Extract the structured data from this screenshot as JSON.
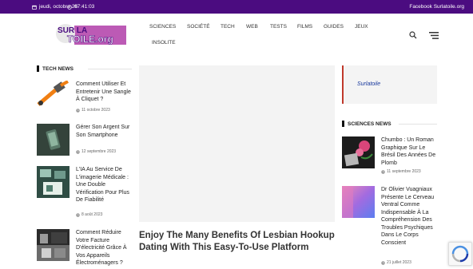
{
  "topbar": {
    "date": "jeudi, octobre 26",
    "time": "07:41:03",
    "facebook": "Facebook Surlatoile.org"
  },
  "logo": {
    "line1": "SUR LA",
    "line2": "TOILE.org"
  },
  "nav": {
    "items": [
      "SCIENCES",
      "SOCIÉTÉ",
      "TECH",
      "WEB",
      "TESTS",
      "FILMS",
      "GUIDES",
      "JEUX",
      "INSOLITE"
    ]
  },
  "icons": {
    "date": "calendar-icon",
    "time": "clock-icon",
    "search": "search-icon",
    "menu": "hamburger-menu-icon",
    "post_date": "clock-icon",
    "recaptcha": "recaptcha-icon"
  },
  "tech_news": {
    "title": "TECH NEWS",
    "posts": [
      {
        "title": "Comment Utiliser Et Entretenir Une Sangle À Cliquet ?",
        "date": "11 octobre 2023"
      },
      {
        "title": "Gérer Son Argent Sur Son Smartphone",
        "date": "12 septembre 2023"
      },
      {
        "title": "L'IA Au Service De L'imagerie Médicale : Une Double Vérification Pour Plus De Fiabilité",
        "date": "8 août 2023"
      },
      {
        "title": "Comment Réduire Votre Facture D'électricité Grâce À Vos Appareils Électroménagers ?",
        "date": ""
      }
    ]
  },
  "main": {
    "article_title": "Enjoy The Many Benefits Of Lesbian Hookup Dating With This Easy-To-Use Platform"
  },
  "sidebar": {
    "link": "Surlatoile",
    "sciences_news": {
      "title": "SCIENCES NEWS",
      "posts": [
        {
          "title": "Chumbo : Un Roman Graphique Sur Le Brésil Des Années De Plomb",
          "date": "11 septembre 2023"
        },
        {
          "title": "Dr Olivier Vuagniaux Présente Le Cerveau Ventral Comme Indispensable À La Compréhension Des Troubles Psychiques Dans Le Corps Conscient",
          "date": "21 juillet 2023"
        }
      ]
    }
  },
  "colors": {
    "topbar": "#4b0c80",
    "accent_red": "#c0392b",
    "link_blue": "#1a3a9e"
  }
}
